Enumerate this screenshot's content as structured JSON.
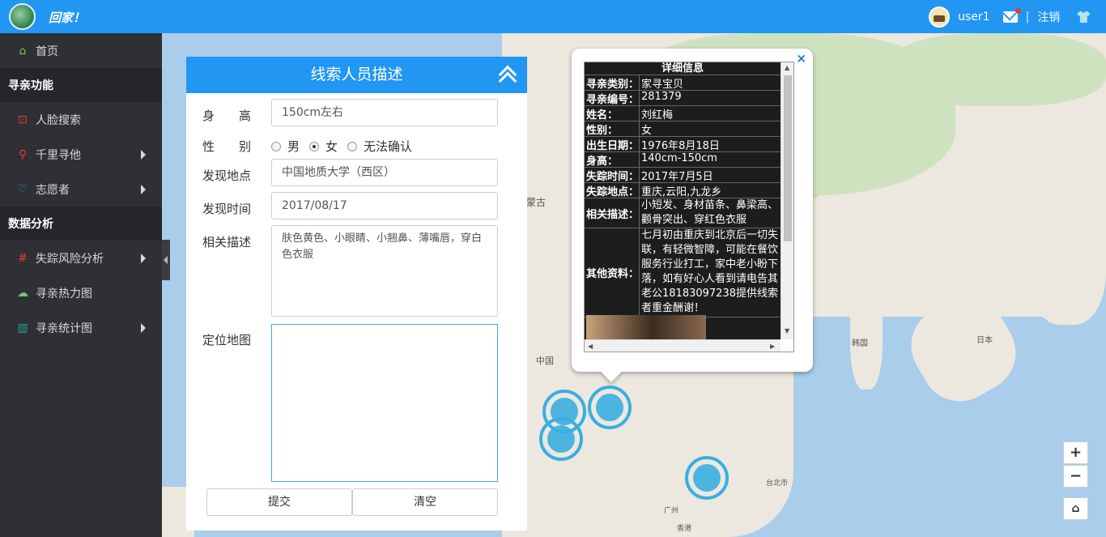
{
  "header": {
    "logo_text": "回家！",
    "username": "user1",
    "separator": "|",
    "logout_label": "注销"
  },
  "sidebar": {
    "items": [
      {
        "label": "首页",
        "icon": "home-icon",
        "type": "item"
      },
      {
        "label": "寻亲功能",
        "type": "section"
      },
      {
        "label": "人脸搜索",
        "icon": "face-scan-icon",
        "type": "item"
      },
      {
        "label": "千里寻他",
        "icon": "search-person-icon",
        "type": "item",
        "submenu": true
      },
      {
        "label": "志愿者",
        "icon": "heart-icon",
        "type": "item",
        "submenu": true
      },
      {
        "label": "数据分析",
        "type": "section"
      },
      {
        "label": "失踪风险分析",
        "icon": "grid-icon",
        "type": "item",
        "submenu": true
      },
      {
        "label": "寻亲热力图",
        "icon": "heatmap-icon",
        "type": "item"
      },
      {
        "label": "寻亲统计图",
        "icon": "bar-chart-icon",
        "type": "item",
        "submenu": true
      }
    ]
  },
  "form": {
    "title": "线索人员描述",
    "height_label": "身　　高",
    "height_value": "150cm左右",
    "gender_label": "性　　别",
    "gender_options": [
      "男",
      "女",
      "无法确认"
    ],
    "gender_selected": "女",
    "location_label": "发现地点",
    "location_value": "中国地质大学（西区）",
    "time_label": "发现时间",
    "time_value": "2017/08/17",
    "desc_label": "相关描述",
    "desc_value": "肤色黄色、小眼睛、小翘鼻、薄嘴唇，穿白色衣服",
    "map_label": "定位地图",
    "submit_label": "提交",
    "clear_label": "清空"
  },
  "popup": {
    "close": "×",
    "title": "详细信息",
    "rows": [
      {
        "key": "寻亲类别：",
        "value": "家寻宝贝"
      },
      {
        "key": "寻亲编号：",
        "value": "281379"
      },
      {
        "key": "姓名：",
        "value": "刘红梅"
      },
      {
        "key": "性别：",
        "value": "女"
      },
      {
        "key": "出生日期：",
        "value": "1976年8月18日"
      },
      {
        "key": "身高：",
        "value": "140cm-150cm"
      },
      {
        "key": "失踪时间：",
        "value": "2017年7月5日"
      },
      {
        "key": "失踪地点：",
        "value": "重庆,云阳,九龙乡"
      },
      {
        "key": "相关描述：",
        "value": "小短发、身材苗条、鼻梁高、颧骨突出、穿红色衣服"
      },
      {
        "key": "其他资料：",
        "value": "七月初由重庆到北京后一切失联，有轻微智障，可能在餐饮服务行业打工，家中老小盼下落，如有好心人看到请电告其老公18183097238提供线索者重金酬谢！"
      }
    ]
  },
  "map": {
    "labels": [
      "蒙古",
      "中国",
      "韩国",
      "日本",
      "台北市",
      "广州",
      "香港"
    ],
    "zoom_in": "+",
    "zoom_out": "−",
    "home": "⌂"
  }
}
